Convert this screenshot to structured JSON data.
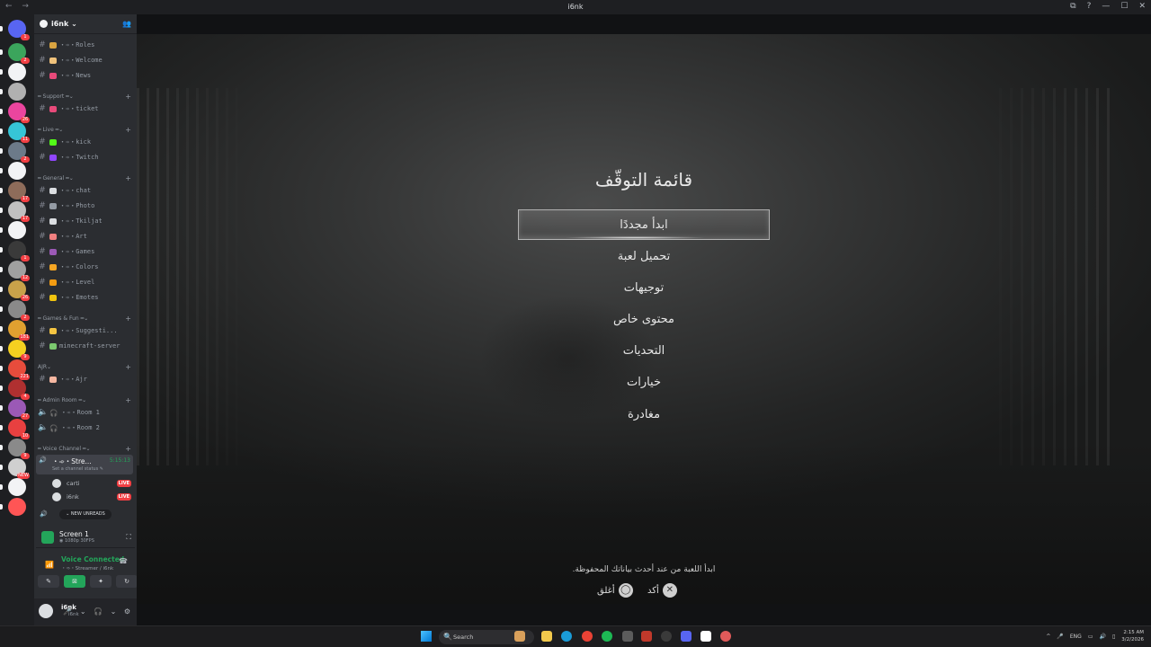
{
  "window": {
    "title": "i6nk",
    "nav_glyph": "← →",
    "controls": [
      "⧉",
      "?",
      "—",
      "☐",
      "✕"
    ]
  },
  "servers": {
    "badges": [
      "1",
      "2",
      "",
      "",
      "26",
      "11",
      "2",
      "",
      "17",
      "17",
      "",
      "1",
      "12",
      "26",
      "2",
      "181",
      "9",
      "221",
      "4",
      "27",
      "10",
      "9",
      "NEW"
    ]
  },
  "sidebar": {
    "server_name": "i6nk",
    "invite_icon": "👥",
    "channels_top": [
      {
        "label": "・➾・Roles",
        "emoji_color": "#d9a441"
      },
      {
        "label": "・➾・Welcome",
        "emoji_color": "#f0c27b"
      },
      {
        "label": "・➾・News",
        "emoji_color": "#e84a7a"
      }
    ],
    "categories": {
      "support": "━ Support ━",
      "live": "━ Live ━",
      "general": "━ General ━",
      "games": "━ Games & Fun ━",
      "ajr": "AJR",
      "admin": "━ Admin Room ━",
      "voice": "━ Voice Channel ━"
    },
    "channels_support": [
      {
        "label": "・➾・ticket",
        "emoji_color": "#e84a7a"
      }
    ],
    "channels_live": [
      {
        "label": "・➾・kick",
        "emoji_color": "#53fc18"
      },
      {
        "label": "・➾・Twitch",
        "emoji_color": "#9146ff"
      }
    ],
    "channels_general": [
      {
        "label": "・➾・chat",
        "emoji_color": "#dbdee1"
      },
      {
        "label": "・➾・Photo",
        "emoji_color": "#949ba4"
      },
      {
        "label": "・➾・Tkiljat",
        "emoji_color": "#dbdee1"
      },
      {
        "label": "・➾・Art",
        "emoji_color": "#f08080"
      },
      {
        "label": "・➾・Games",
        "emoji_color": "#9b59b6"
      },
      {
        "label": "・➾・Colors",
        "emoji_color": "#f5a623"
      },
      {
        "label": "・➾・Level",
        "emoji_color": "#f39c12"
      },
      {
        "label": "・➾・Emotes",
        "emoji_color": "#f1c40f"
      }
    ],
    "channels_games": [
      {
        "label": "・➾・Suggesti...",
        "emoji_color": "#f5c542"
      },
      {
        "label": "minecraft-server",
        "emoji_color": "#7bc96f"
      }
    ],
    "channels_ajr": [
      {
        "label": "・➾・Ajr",
        "emoji_color": "#f5b7a1"
      }
    ],
    "channels_admin": [
      {
        "label": "・➾・Room 1"
      },
      {
        "label": "・➾・Room 2"
      }
    ],
    "stream_channel": {
      "name": "・➾・Stre...",
      "time": "5:15:13",
      "status": "Set a channel status ✎"
    },
    "voice_users": [
      {
        "name": "carti",
        "live": "LIVE"
      },
      {
        "name": "i6nk",
        "live": "LIVE"
      }
    ],
    "new_unreads": "NEW UNREADS"
  },
  "screen_panel": {
    "title": "Screen 1",
    "subtitle": "◉ 1080p 30FPS",
    "icon": "⛶"
  },
  "voice_panel": {
    "status": "Voice Connected",
    "subtitle": "・➾・Streamer / i6nk",
    "signal_icon": "📶",
    "buttons": [
      "✎",
      "⊠",
      "✦",
      "↻"
    ]
  },
  "user_panel": {
    "username": "i6nk",
    "status": "i6nk",
    "controls": "🎤 ⌄ 🎧 ⌄ ⚙"
  },
  "game": {
    "title": "قائمة التوقّف",
    "menu": [
      {
        "label": "ابدأ مجددًا",
        "selected": true
      },
      {
        "label": "تحميل لعبة"
      },
      {
        "label": "توجيهات"
      },
      {
        "label": "محتوى خاص"
      },
      {
        "label": "التحديات"
      },
      {
        "label": "خيارات"
      },
      {
        "label": "مغادرة"
      }
    ],
    "hint": "ابدأ اللعبة من عند أحدث بياناتك المحفوظة.",
    "confirm_label": "أكد",
    "confirm_glyph": "✕",
    "close_label": "أغلق",
    "close_glyph": "◯"
  },
  "taskbar": {
    "search_placeholder": "Search",
    "search_icon": "🔍",
    "tray_arrow": "^",
    "language": "ENG",
    "time": "2:15 AM",
    "date": "3/2/2026"
  }
}
